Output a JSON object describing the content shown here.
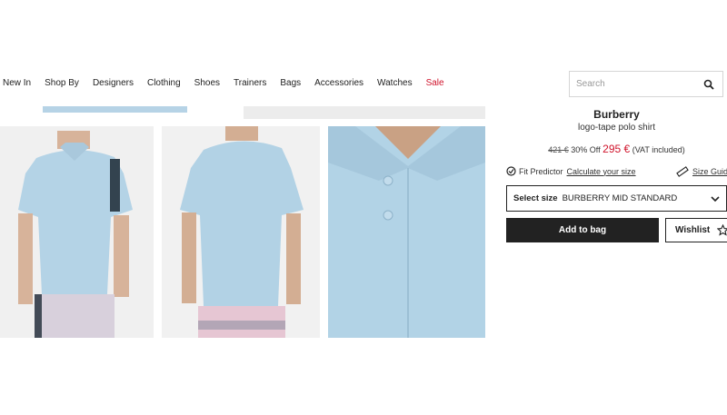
{
  "nav": {
    "items": [
      "New In",
      "Shop By",
      "Designers",
      "Clothing",
      "Shoes",
      "Trainers",
      "Bags",
      "Accessories",
      "Watches",
      "Sale"
    ]
  },
  "search": {
    "placeholder": "Search"
  },
  "product": {
    "brand": "Burberry",
    "name": "logo-tape polo shirt",
    "old_price": "421 €",
    "discount": "30% Off",
    "price": "295 €",
    "vat": "(VAT included)"
  },
  "fit": {
    "label": "Fit Predictor",
    "link": "Calculate your size"
  },
  "size_guide": {
    "label": "Size Guide"
  },
  "size_select": {
    "label": "Select size",
    "value": "BURBERRY MID STANDARD"
  },
  "buttons": {
    "add_to_bag": "Add to bag",
    "wishlist": "Wishlist"
  },
  "colors": {
    "sale": "#d0142c",
    "shirt": "#b2d3e6",
    "dark": "#222222"
  }
}
